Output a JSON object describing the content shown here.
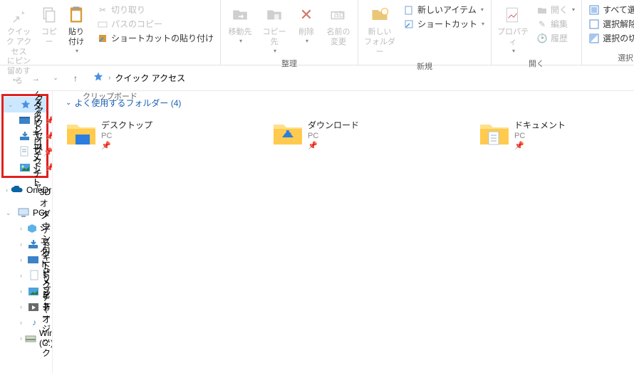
{
  "ribbon": {
    "groups": {
      "clipboard": {
        "label": "クリップボード",
        "pin": "クイック アクセス\nにピン留めする",
        "copy": "コピー",
        "paste": "貼り付け",
        "cut": "切り取り",
        "copy_path": "パスのコピー",
        "paste_shortcut": "ショートカットの貼り付け"
      },
      "organize": {
        "label": "整理",
        "move_to": "移動先",
        "copy_to": "コピー先",
        "delete": "削除",
        "rename": "名前の\n変更"
      },
      "new": {
        "label": "新規",
        "new_folder": "新しい\nフォルダー",
        "new_item": "新しいアイテム",
        "shortcut": "ショートカット"
      },
      "open": {
        "label": "開く",
        "properties": "プロパティ",
        "open": "開く",
        "edit": "編集",
        "history": "履歴"
      },
      "select": {
        "label": "選択",
        "select_all": "すべて選択",
        "select_none": "選択解除",
        "invert": "選択の切り替え"
      }
    }
  },
  "breadcrumb": {
    "current": "クイック アクセス"
  },
  "tree": {
    "quick_access": "クイック アクセス",
    "desktop": "デスクトップ",
    "downloads": "ダウンロード",
    "documents": "ドキュメント",
    "pictures": "ピクチャ",
    "onedrive": "OneDrive",
    "pc": "PC",
    "objects3d": "3D オブジェクト",
    "downloads2": "ダウンロード",
    "desktop2": "デスクトップ",
    "documents2": "ドキュメント",
    "pictures2": "ピクチャ",
    "videos": "ビデオ",
    "music": "ミュージック",
    "windowsc": "Windows (C:)"
  },
  "content": {
    "section_title": "よく使用するフォルダー (4)",
    "items": [
      {
        "name": "デスクトップ",
        "location": "PC"
      },
      {
        "name": "ダウンロード",
        "location": "PC"
      },
      {
        "name": "ドキュメント",
        "location": "PC"
      }
    ]
  }
}
